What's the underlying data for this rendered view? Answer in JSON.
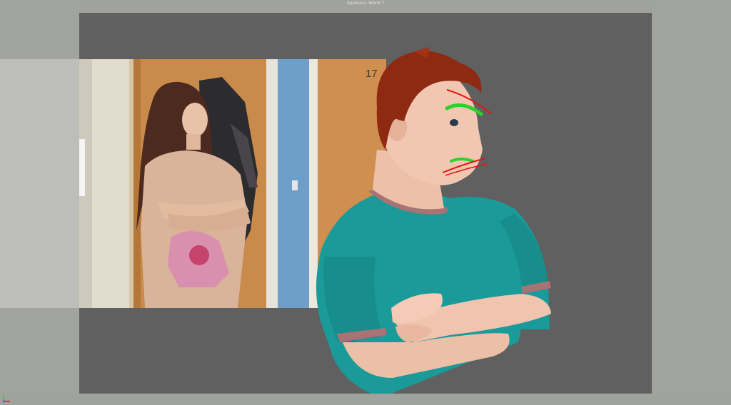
{
  "viewport": {
    "title": "Sponsors: World 7",
    "camera_gate_color": "#5f605f",
    "background_color": "#9fa19c"
  },
  "reference_plate": {
    "frame_number": "17",
    "description_icon": "reference-video-frame"
  },
  "character": {
    "shirt_color": "#1a9a99",
    "skin_color": "#f0c4ae",
    "hair_color": "#8f2a12",
    "brow_curve_color": "#2ed02e",
    "guide_curve_color": "#e01515"
  },
  "axis_gizmo": {
    "icon": "axis-gizmo-icon"
  }
}
